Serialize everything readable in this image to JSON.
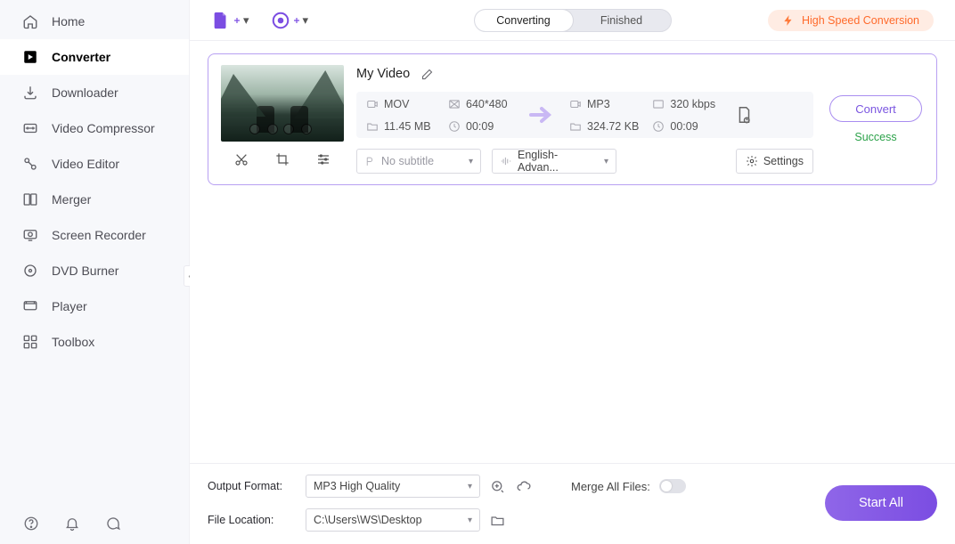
{
  "sidebar": {
    "items": [
      {
        "label": "Home",
        "icon": "home-icon"
      },
      {
        "label": "Converter",
        "icon": "converter-icon"
      },
      {
        "label": "Downloader",
        "icon": "downloader-icon"
      },
      {
        "label": "Video Compressor",
        "icon": "compressor-icon"
      },
      {
        "label": "Video Editor",
        "icon": "editor-icon"
      },
      {
        "label": "Merger",
        "icon": "merger-icon"
      },
      {
        "label": "Screen Recorder",
        "icon": "recorder-icon"
      },
      {
        "label": "DVD Burner",
        "icon": "dvdburner-icon"
      },
      {
        "label": "Player",
        "icon": "player-icon"
      },
      {
        "label": "Toolbox",
        "icon": "toolbox-icon"
      }
    ],
    "active_index": 1
  },
  "topbar": {
    "tabs": {
      "converting": "Converting",
      "finished": "Finished",
      "active": "converting"
    },
    "high_speed_label": "High Speed Conversion"
  },
  "task": {
    "title": "My Video",
    "source": {
      "format": "MOV",
      "resolution": "640*480",
      "size": "11.45 MB",
      "duration": "00:09"
    },
    "target": {
      "format": "MP3",
      "bitrate": "320 kbps",
      "size": "324.72 KB",
      "duration": "00:09"
    },
    "subtitle_select": "No subtitle",
    "audio_select": "English-Advan...",
    "settings_label": "Settings",
    "convert_label": "Convert",
    "status": "Success"
  },
  "bottom": {
    "output_format_label": "Output Format:",
    "output_format_value": "MP3 High Quality",
    "file_location_label": "File Location:",
    "file_location_value": "C:\\Users\\WS\\Desktop",
    "merge_label": "Merge All Files:",
    "start_all_label": "Start All"
  },
  "colors": {
    "accent": "#7b4de2",
    "card_border": "#b8a0f2",
    "success": "#2ca24a",
    "hs_bg": "#ffece3",
    "hs_fg": "#ff6a2b"
  }
}
